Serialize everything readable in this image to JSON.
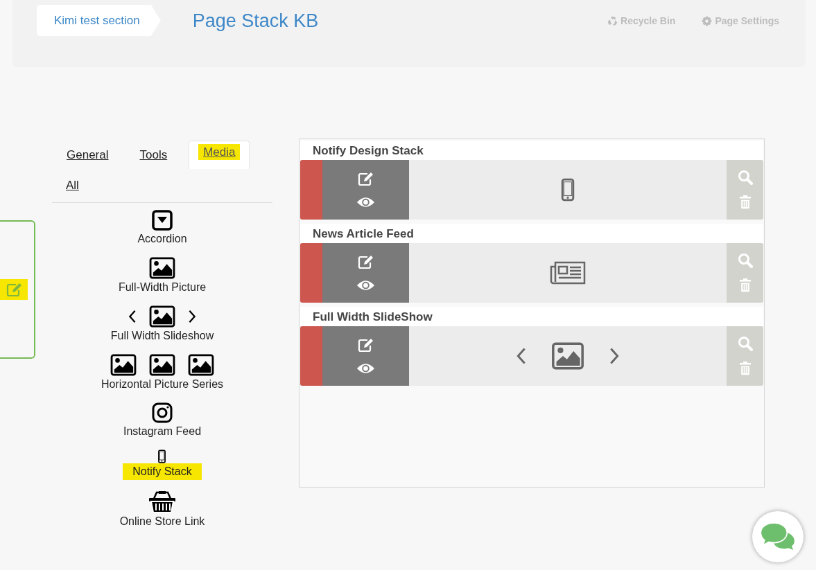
{
  "breadcrumb": {
    "label": "Kimi test section"
  },
  "page_title": "Page Stack KB",
  "header_actions": [
    {
      "kind": "recycle",
      "label": "Recycle Bin"
    },
    {
      "kind": "settings",
      "label": "Page Settings"
    }
  ],
  "side_edit_tab": {
    "selected": true
  },
  "tabs": [
    {
      "label": "General",
      "selected": false
    },
    {
      "label": "Tools",
      "selected": false
    },
    {
      "label": "Media",
      "selected": true
    }
  ],
  "filter_link": "All",
  "palette": [
    {
      "kind": "accordion",
      "label": "Accordion",
      "selected": false
    },
    {
      "kind": "picture",
      "label": "Full-Width Picture",
      "selected": false
    },
    {
      "kind": "slideshow",
      "label": "Full Width Slideshow",
      "selected": false
    },
    {
      "kind": "series",
      "label": "Horizontal Picture Series",
      "selected": false
    },
    {
      "kind": "instagram",
      "label": "Instagram Feed",
      "selected": false
    },
    {
      "kind": "phone",
      "label": "Notify Stack",
      "selected": true
    },
    {
      "kind": "basket",
      "label": "Online Store Link",
      "selected": false
    }
  ],
  "stack": [
    {
      "title": "Notify Design Stack",
      "kind": "phone"
    },
    {
      "title": "News Article Feed",
      "kind": "newspaper"
    },
    {
      "title": "Full Width SlideShow",
      "kind": "slideshow"
    }
  ]
}
